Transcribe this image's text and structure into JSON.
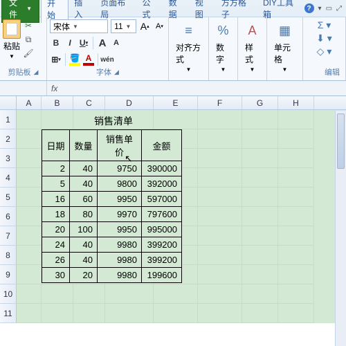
{
  "tabs": {
    "file": "文件",
    "home": "开始",
    "insert": "插入",
    "layout": "页面布局",
    "formula": "公式",
    "data": "数据",
    "view": "视图",
    "fgz": "方方格子",
    "diy": "DIY工具箱"
  },
  "ribbon": {
    "clipboard": {
      "paste": "粘贴",
      "label": "剪贴板"
    },
    "font": {
      "name": "宋体",
      "size": "11",
      "bold": "B",
      "italic": "I",
      "underline": "U",
      "grow": "A",
      "shrink": "A",
      "wen": "wén",
      "label": "字体"
    },
    "align": {
      "label": "对齐方式"
    },
    "number": {
      "label": "数字"
    },
    "style": {
      "label": "样式"
    },
    "cells": {
      "label": "单元格"
    },
    "edit": {
      "sigma": "Σ",
      "label": "编辑"
    }
  },
  "formula_bar": {
    "fx": "fx"
  },
  "columns": [
    "A",
    "B",
    "C",
    "D",
    "E",
    "F",
    "G",
    "H"
  ],
  "rows": [
    "1",
    "2",
    "3",
    "4",
    "5",
    "6",
    "7",
    "8",
    "9",
    "10",
    "11"
  ],
  "sheet": {
    "title": "销售清单",
    "headers": {
      "date": "日期",
      "qty": "数量",
      "price": "销售单价",
      "amount": "金额"
    },
    "data": [
      {
        "d": "2",
        "q": "40",
        "p": "9750",
        "a": "390000"
      },
      {
        "d": "5",
        "q": "40",
        "p": "9800",
        "a": "392000"
      },
      {
        "d": "16",
        "q": "60",
        "p": "9950",
        "a": "597000"
      },
      {
        "d": "18",
        "q": "80",
        "p": "9970",
        "a": "797600"
      },
      {
        "d": "20",
        "q": "100",
        "p": "9950",
        "a": "995000"
      },
      {
        "d": "24",
        "q": "40",
        "p": "9980",
        "a": "399200"
      },
      {
        "d": "26",
        "q": "40",
        "p": "9980",
        "a": "399200"
      },
      {
        "d": "30",
        "q": "20",
        "p": "9980",
        "a": "199600"
      }
    ]
  }
}
